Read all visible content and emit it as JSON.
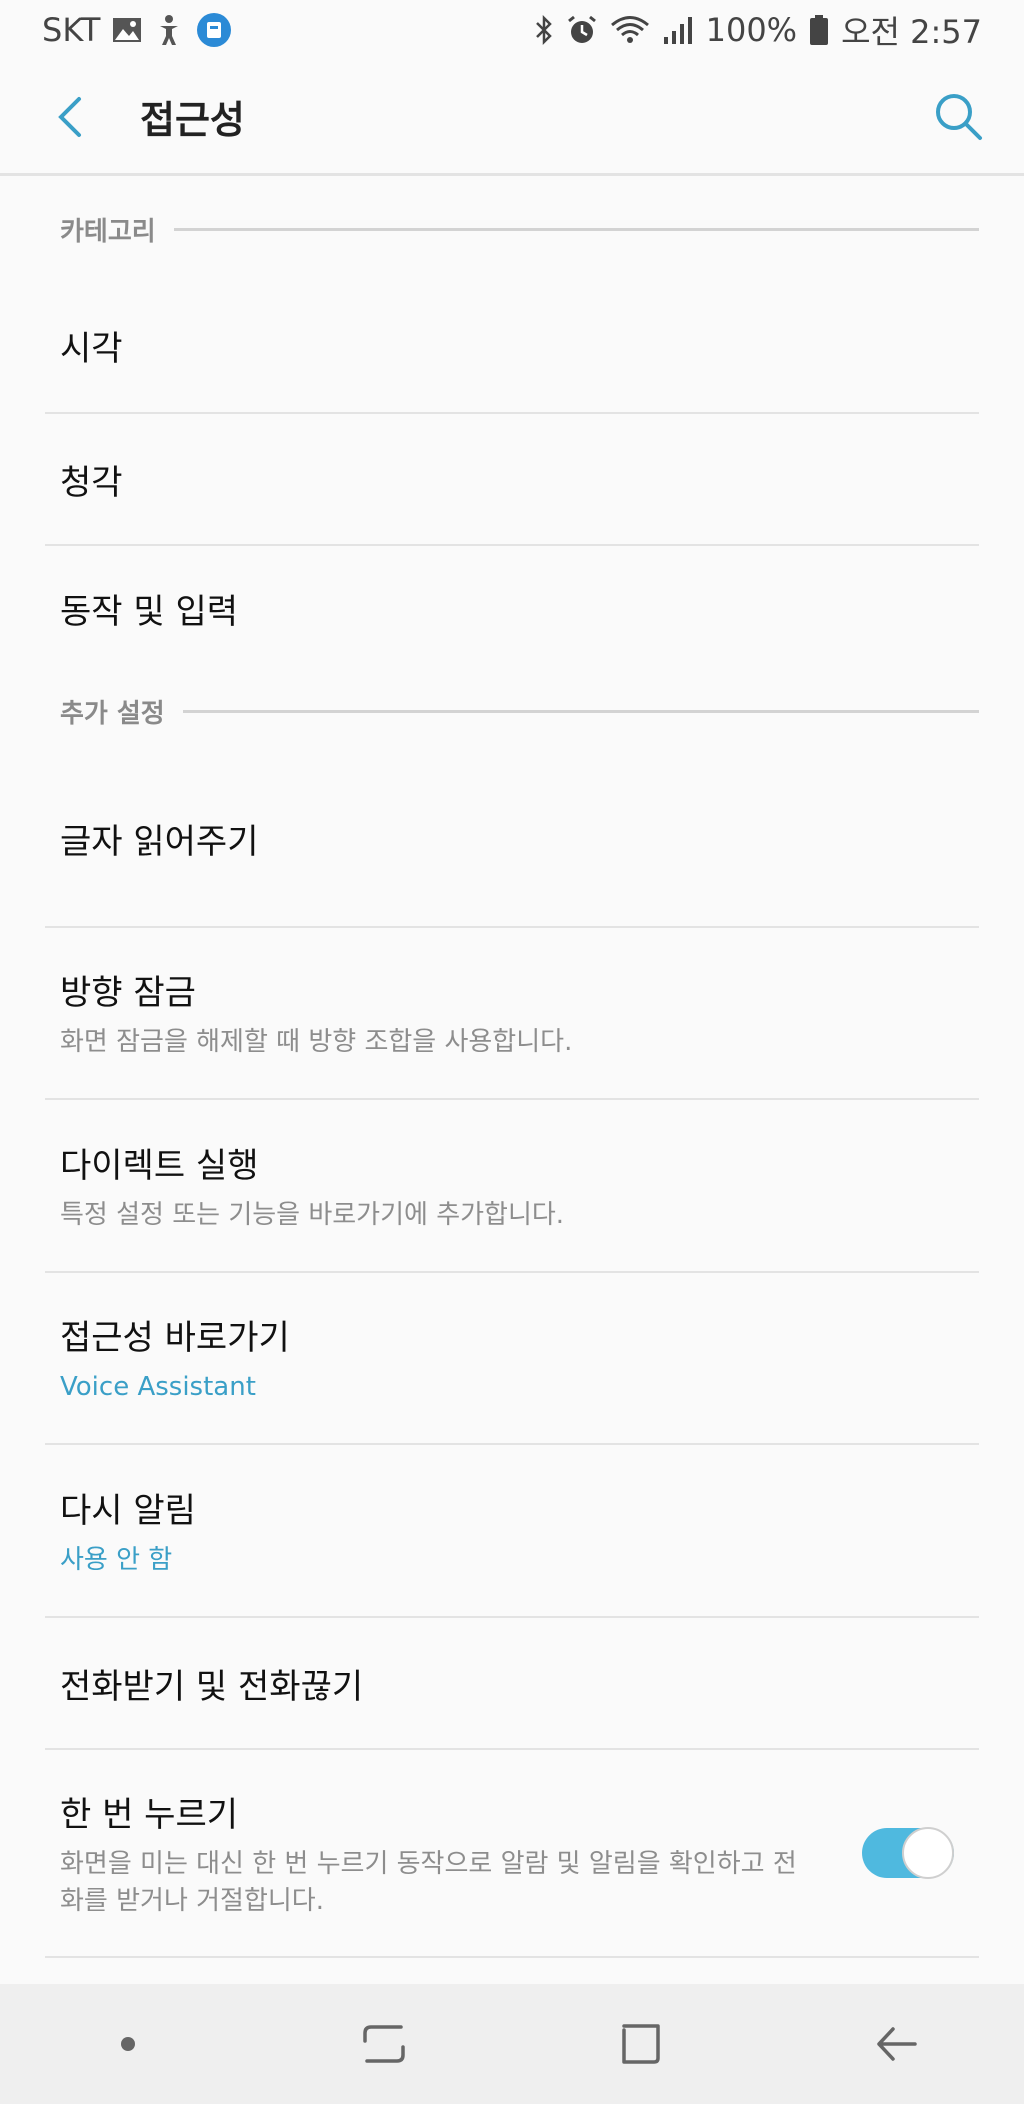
{
  "status": {
    "carrier": "SKT",
    "battery": "100%",
    "time": "오전 2:57",
    "icons": [
      "image-icon",
      "accessibility-icon",
      "app-notification-icon",
      "bluetooth-icon",
      "alarm-icon",
      "wifi-icon",
      "signal-icon",
      "battery-icon"
    ]
  },
  "appbar": {
    "title": "접근성"
  },
  "sections": {
    "category": "카테고리",
    "additional": "추가 설정"
  },
  "items": {
    "vision": {
      "title": "시각"
    },
    "hearing": {
      "title": "청각"
    },
    "interaction": {
      "title": "동작 및 입력"
    },
    "tts": {
      "title": "글자 읽어주기"
    },
    "direction_lock": {
      "title": "방향 잠금",
      "subtitle": "화면 잠금을 해제할 때 방향 조합을 사용합니다."
    },
    "direct_access": {
      "title": "다이렉트 실행",
      "subtitle": "특정 설정 또는 기능을 바로가기에 추가합니다."
    },
    "shortcut": {
      "title": "접근성 바로가기",
      "subtitle": "Voice Assistant"
    },
    "reminder": {
      "title": "다시 알림",
      "subtitle": "사용 안 함"
    },
    "answer_end_calls": {
      "title": "전화받기 및 전화끊기"
    },
    "single_tap": {
      "title": "한 번 누르기",
      "subtitle": "화면을 미는 대신 한 번 누르기 동작으로 알람 및 알림을 확인하고 전화를 받거나 거절합니다.",
      "enabled": true
    }
  },
  "colors": {
    "accent": "#3a9fc7",
    "toggle_on": "#4fb9df"
  }
}
